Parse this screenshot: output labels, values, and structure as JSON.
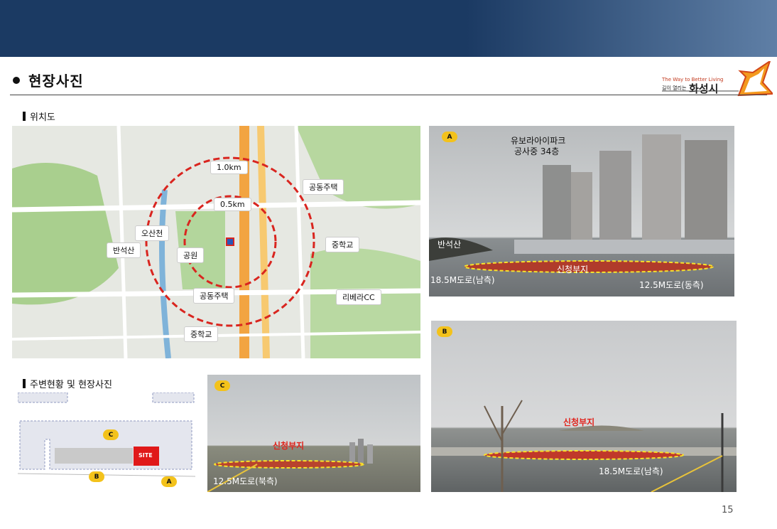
{
  "header": {
    "bullet_title": "현장사진"
  },
  "logo": {
    "tagline": "The Way to Better Living",
    "small": "길이 열리는",
    "city": "화성시"
  },
  "sections": {
    "location": "위치도",
    "surroundings": "주변현황 및 현장사진"
  },
  "map": {
    "labels": {
      "r1": "1.0km",
      "r05": "0.5km",
      "house_top": "공동주택",
      "osanchun": "오산천",
      "banseok": "반석산",
      "park": "공원",
      "middle_school_right": "중학교",
      "house_bottom": "공동주택",
      "riviera": "리베라CC",
      "middle_school_bottom": "중학교"
    }
  },
  "photoA": {
    "badge": "A",
    "caption_line1": "유보라아이파크",
    "caption_line2": "공사중 34층",
    "mountain": "반석산",
    "site": "신청부지",
    "road_left": "18.5M도로(남측)",
    "road_right": "12.5M도로(동측)"
  },
  "photoB": {
    "badge": "B",
    "site": "신청부지",
    "road": "18.5M도로(남측)"
  },
  "photoC": {
    "badge": "C",
    "site": "신청부지",
    "road": "12.5M도로(북측)"
  },
  "siteplan": {
    "site": "SITE",
    "badge_a": "A",
    "badge_b": "B",
    "badge_c": "C"
  },
  "page_number": "15",
  "colors": {
    "header": "#1b3a63",
    "accent_red": "#e0241d",
    "badge": "#f3c21b"
  }
}
